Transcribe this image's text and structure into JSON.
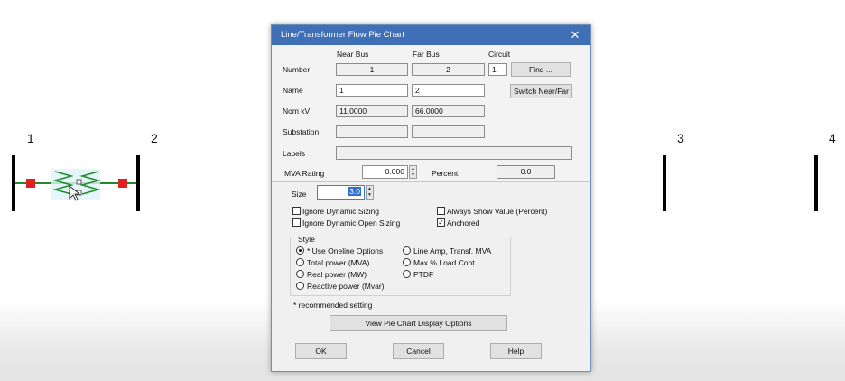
{
  "oneline": {
    "bus_labels": [
      "1",
      "2",
      "3",
      "4"
    ],
    "colors": {
      "branch": "#1f8a2a",
      "breaker": "#e02020",
      "bus": "#000000"
    }
  },
  "dialog": {
    "title": "Line/Transformer Flow Pie Chart",
    "close_icon": "close-icon",
    "columns": {
      "near": "Near Bus",
      "far": "Far Bus",
      "circuit": "Circuit"
    },
    "rows": {
      "number": "Number",
      "name": "Name",
      "nomkv": "Nom kV",
      "substation": "Substation",
      "labels": "Labels"
    },
    "number": {
      "near": "1",
      "far": "2",
      "circuit": "1"
    },
    "name": {
      "near": "1",
      "far": "2"
    },
    "nomkv": {
      "near": "11.0000",
      "far": "66.0000"
    },
    "substation": {
      "near": "",
      "far": ""
    },
    "labels_value": "",
    "buttons": {
      "find": "Find ...",
      "switch": "Switch Near/Far"
    },
    "mva_rating": {
      "label": "MVA Rating",
      "value": "0.000"
    },
    "percent": {
      "label": "Percent",
      "value": "0.0"
    },
    "size": {
      "label": "Size",
      "value": "3.0"
    },
    "checks": {
      "ignore_dynamic_sizing": {
        "label": "Ignore Dynamic Sizing",
        "checked": false
      },
      "ignore_dynamic_open_sizing": {
        "label": "Ignore Dynamic Open Sizing",
        "checked": false
      },
      "always_show_value": {
        "label": "Always Show Value (Percent)",
        "checked": false
      },
      "anchored": {
        "label": "Anchored",
        "checked": true
      }
    },
    "style": {
      "label": "Style",
      "options": [
        {
          "label": "* Use Oneline Options",
          "selected": true
        },
        {
          "label": "Total power (MVA)",
          "selected": false
        },
        {
          "label": "Real power (MW)",
          "selected": false
        },
        {
          "label": "Reactive power (Mvar)",
          "selected": false
        },
        {
          "label": "Line Amp, Transf. MVA",
          "selected": false
        },
        {
          "label": "Max % Load Cont.",
          "selected": false
        },
        {
          "label": "PTDF",
          "selected": false
        }
      ]
    },
    "recommended_note": "* recommended setting",
    "view_options_button": "View Pie Chart Display Options",
    "footer": {
      "ok": "OK",
      "cancel": "Cancel",
      "help": "Help"
    }
  }
}
